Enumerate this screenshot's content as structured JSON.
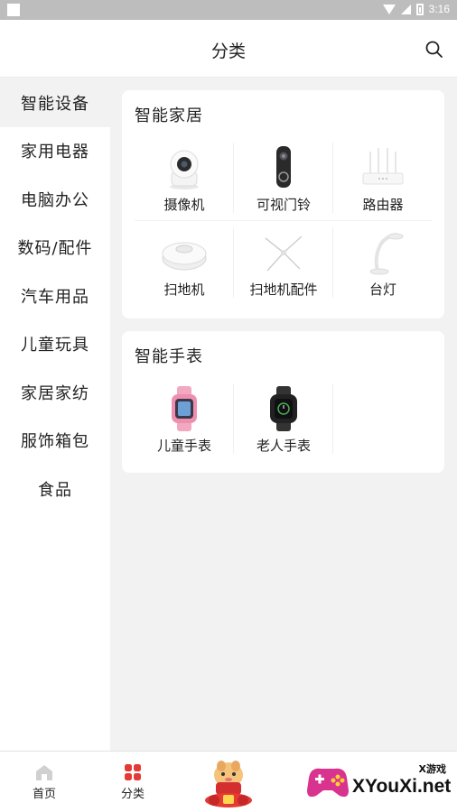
{
  "status_bar": {
    "time": "3:16"
  },
  "header": {
    "title": "分类",
    "search_icon": "search-icon"
  },
  "sidebar": {
    "items": [
      {
        "label": "智能设备",
        "active": true
      },
      {
        "label": "家用电器"
      },
      {
        "label": "电脑办公"
      },
      {
        "label": "数码/配件"
      },
      {
        "label": "汽车用品"
      },
      {
        "label": "儿童玩具"
      },
      {
        "label": "家居家纺"
      },
      {
        "label": "服饰箱包"
      },
      {
        "label": "食品"
      }
    ]
  },
  "sections": [
    {
      "title": "智能家居",
      "items": [
        {
          "label": "摄像机",
          "icon": "camera-icon"
        },
        {
          "label": "可视门铃",
          "icon": "doorbell-icon"
        },
        {
          "label": "路由器",
          "icon": "router-icon"
        },
        {
          "label": "扫地机",
          "icon": "robot-vacuum-icon"
        },
        {
          "label": "扫地机配件",
          "icon": "brush-accessory-icon"
        },
        {
          "label": "台灯",
          "icon": "desk-lamp-icon"
        }
      ]
    },
    {
      "title": "智能手表",
      "items": [
        {
          "label": "儿童手表",
          "icon": "kids-watch-icon"
        },
        {
          "label": "老人手表",
          "icon": "elder-watch-icon"
        }
      ]
    }
  ],
  "tabbar": {
    "items": [
      {
        "label": "首页",
        "icon": "home-icon"
      },
      {
        "label": "分类",
        "icon": "category-icon",
        "active": true
      },
      {
        "label": "",
        "icon": "new-year-mascot-icon"
      }
    ]
  },
  "watermark": {
    "small": "X游戏",
    "big": "XYouXi.net"
  },
  "colors": {
    "accent": "#e53935",
    "background": "#f2f2f2"
  }
}
